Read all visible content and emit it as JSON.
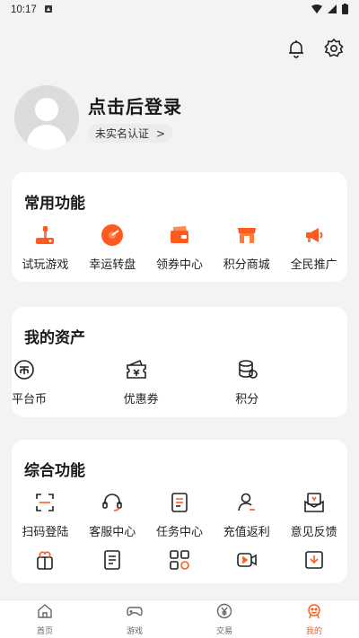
{
  "status_bar": {
    "time": "10:17"
  },
  "header": {
    "bell_icon": "bell-icon",
    "settings_icon": "gear-icon"
  },
  "profile": {
    "login_text": "点击后登录",
    "auth_label": "未实名认证",
    "auth_chevron": ">"
  },
  "common": {
    "title": "常用功能",
    "items": [
      {
        "label": "试玩游戏",
        "icon": "joystick-icon"
      },
      {
        "label": "幸运转盘",
        "icon": "wheel-icon"
      },
      {
        "label": "领券中心",
        "icon": "coupon-icon"
      },
      {
        "label": "积分商城",
        "icon": "shop-icon"
      },
      {
        "label": "全民推广",
        "icon": "megaphone-icon"
      }
    ]
  },
  "assets": {
    "title": "我的资产",
    "items": [
      {
        "label": "平台币",
        "icon": "coin-icon"
      },
      {
        "label": "优惠券",
        "icon": "voucher-icon"
      },
      {
        "label": "积分",
        "icon": "points-icon"
      }
    ]
  },
  "general": {
    "title": "综合功能",
    "row1": [
      {
        "label": "扫码登陆",
        "icon": "scan-icon"
      },
      {
        "label": "客服中心",
        "icon": "headset-icon"
      },
      {
        "label": "任务中心",
        "icon": "task-icon"
      },
      {
        "label": "充值返利",
        "icon": "user-rebate-icon"
      },
      {
        "label": "意见反馈",
        "icon": "feedback-icon"
      }
    ],
    "row2": [
      {
        "label": "",
        "icon": "gift-icon"
      },
      {
        "label": "",
        "icon": "document-icon"
      },
      {
        "label": "",
        "icon": "apps-icon"
      },
      {
        "label": "",
        "icon": "video-icon"
      },
      {
        "label": "",
        "icon": "download-icon"
      }
    ]
  },
  "nav": {
    "items": [
      {
        "label": "首页",
        "icon": "home-icon"
      },
      {
        "label": "游戏",
        "icon": "gamepad-icon"
      },
      {
        "label": "交易",
        "icon": "trade-icon"
      },
      {
        "label": "我的",
        "icon": "profile-icon"
      }
    ],
    "active_color": "#ff5a1f"
  },
  "colors": {
    "accent": "#ff5a1f",
    "background": "#f3f3f3"
  }
}
